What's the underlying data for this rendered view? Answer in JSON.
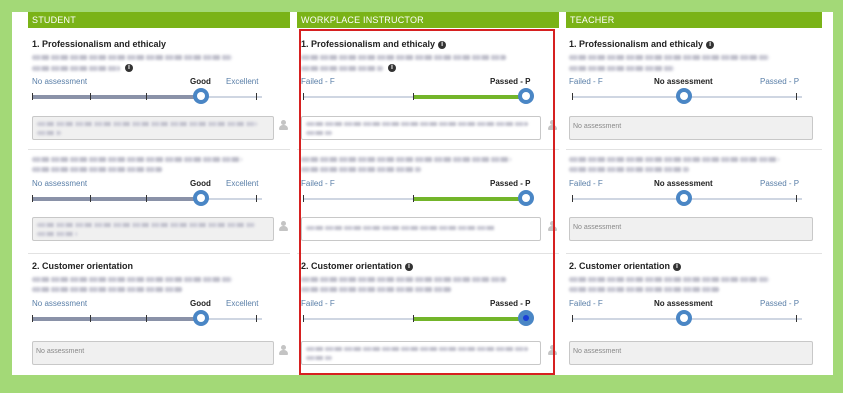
{
  "columns": {
    "student": {
      "header": "STUDENT"
    },
    "instructor": {
      "header": "WORKPLACE INSTRUCTOR"
    },
    "teacher": {
      "header": "TEACHER"
    }
  },
  "sections": {
    "s1": {
      "title": "1. Professionalism and ethicaly"
    },
    "s3": {
      "title": "2. Customer orientation"
    }
  },
  "scales": {
    "student": {
      "left": "No assessment",
      "middle": "Good",
      "right": "Excellent",
      "level": 0.6
    },
    "instructor": {
      "left": "Failed - F",
      "right": "Passed - P",
      "level": 1.0
    },
    "teacher": {
      "left": "Failed - F",
      "middle": "No assessment",
      "right": "Passed - P",
      "level": 0.5
    }
  },
  "comments": {
    "placeholder": "No assessment"
  },
  "icons": {
    "info": "info-icon",
    "person": "person-icon"
  },
  "colors": {
    "header_bar": "#7ab317",
    "background": "#a3d977",
    "knob": "#4a86c5",
    "student_fill": "#8a92a8",
    "instructor_fill": "#73b52a",
    "highlight": "#d62020"
  }
}
